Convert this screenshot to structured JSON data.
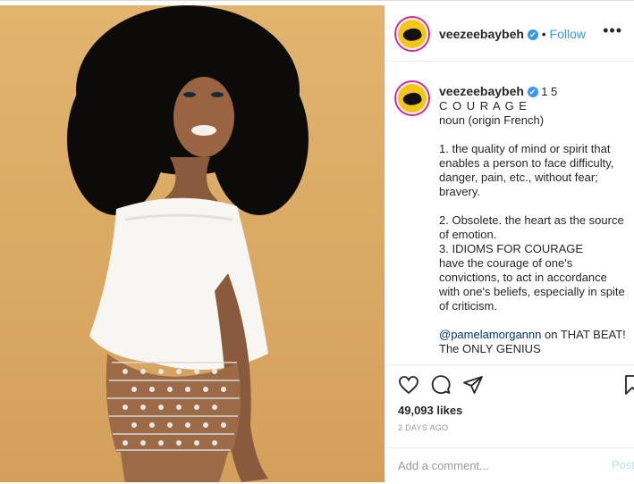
{
  "post": {
    "username": "veezeebaybeh",
    "verified_icon": "✔",
    "follow_label": "Follow",
    "more_icon": "•••"
  },
  "caption": {
    "username": "veezeebaybeh",
    "meta": "1 5",
    "lines": [
      "C O U R A G E",
      "noun (origin French)",
      "",
      "1. the quality of mind or spirit that enables a person to face difficulty, danger, pain, etc., without fear; bravery.",
      "",
      "2. Obsolete. the heart as the source of emotion.",
      "3. IDIOMS FOR COURAGE",
      "have the courage of one's convictions, to act in accordance with one's beliefs, especially in spite of criticism.",
      ""
    ],
    "mention": "@pamelamorgannn",
    "mention_suffix": " on THAT BEAT!",
    "last_line": "The ONLY GENIUS"
  },
  "actions": {
    "likes": "49,093 likes",
    "date": "2 DAYS AGO",
    "comment_placeholder": "Add a comment...",
    "post_label": "Post",
    "icons": [
      "heart-icon",
      "comment-icon",
      "share-icon",
      "bookmark-icon"
    ]
  },
  "colors": {
    "accent": "#3897f0",
    "background_photo": "#dcab63"
  }
}
